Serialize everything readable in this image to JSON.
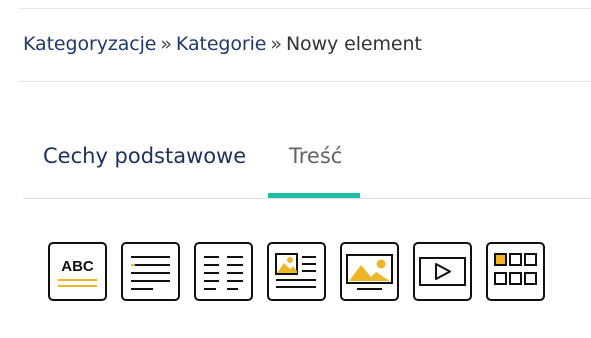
{
  "breadcrumb": {
    "items": [
      "Kategoryzacje",
      "Kategorie"
    ],
    "separator": "»",
    "current": "Nowy element"
  },
  "tabs": [
    {
      "label": "Cechy podstawowe",
      "active": false
    },
    {
      "label": "Treść",
      "active": true
    }
  ],
  "content_types": {
    "text_label": "ABC",
    "icons": [
      "text-block-icon",
      "paragraph-icon",
      "two-columns-icon",
      "image-with-text-icon",
      "image-icon",
      "video-icon",
      "gallery-icon"
    ]
  },
  "colors": {
    "accent": "#1cbfa3",
    "icon_highlight": "#f0b429",
    "link": "#1f3a6b"
  }
}
